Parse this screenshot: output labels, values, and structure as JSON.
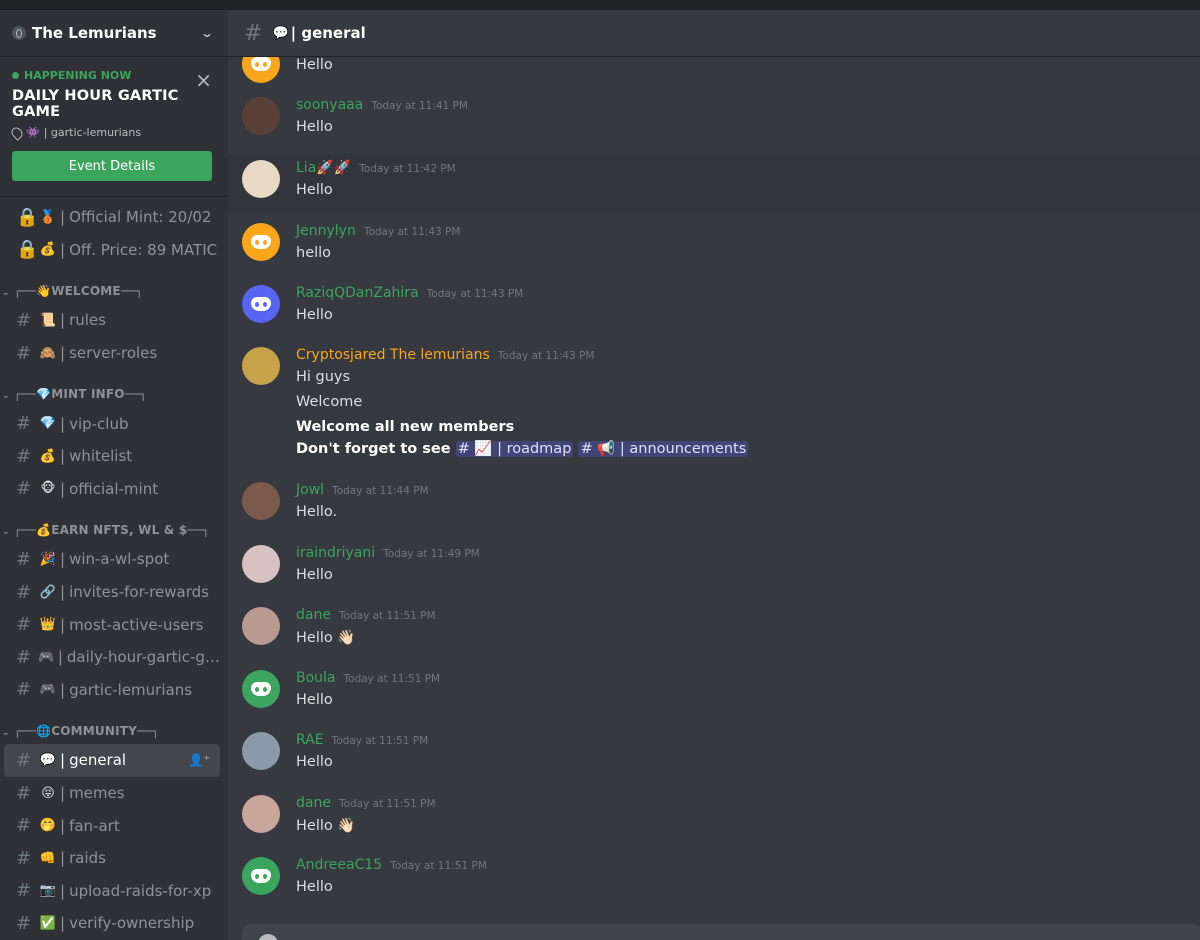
{
  "server": {
    "name": "The Lemurians"
  },
  "event": {
    "happening": "HAPPENING NOW",
    "title": "DAILY HOUR GARTIC GAME",
    "location_emoji": "👾",
    "location": "| gartic-lemurians",
    "button": "Event Details"
  },
  "sidebar": {
    "top_channels": [
      {
        "emoji": "🥉",
        "label": "Official Mint: 20/02"
      },
      {
        "emoji": "💰",
        "label": "Off. Price: 89 MATIC"
      }
    ],
    "categories": [
      {
        "emoji": "👋",
        "label": "WELCOME",
        "channels": [
          {
            "emoji": "📜",
            "label": "rules"
          },
          {
            "emoji": "🙈",
            "label": "server-roles"
          }
        ]
      },
      {
        "emoji": "💎",
        "label": "MINT INFO",
        "channels": [
          {
            "emoji": "💎",
            "label": "vip-club"
          },
          {
            "emoji": "💰",
            "label": "whitelist"
          },
          {
            "emoji": "🐵",
            "label": "official-mint"
          }
        ]
      },
      {
        "emoji": "💰",
        "label": "EARN NFTS, WL & $",
        "channels": [
          {
            "emoji": "🎉",
            "label": "win-a-wl-spot"
          },
          {
            "emoji": "🔗",
            "label": "invites-for-rewards"
          },
          {
            "emoji": "👑",
            "label": "most-active-users"
          },
          {
            "emoji": "🎮",
            "label": "daily-hour-gartic-ga..."
          },
          {
            "emoji": "🎮",
            "label": "gartic-lemurians"
          }
        ]
      },
      {
        "emoji": "🌐",
        "label": "COMMUNITY",
        "channels": [
          {
            "emoji": "💬",
            "label": "general",
            "active": true
          },
          {
            "emoji": "😝",
            "label": "memes"
          },
          {
            "emoji": "🤭",
            "label": "fan-art"
          },
          {
            "emoji": "👊",
            "label": "raids"
          },
          {
            "emoji": "📷",
            "label": "upload-raids-for-xp"
          },
          {
            "emoji": "✅",
            "label": "verify-ownership"
          }
        ]
      }
    ]
  },
  "channel_header": {
    "emoji": "💬",
    "title": "| general"
  },
  "colors": {
    "green_name": "#3ba55d",
    "orange_name": "#faa61a",
    "mention_bg": "#5865f2"
  },
  "messages": [
    {
      "author": "",
      "time": "",
      "avatar": "discord-orange",
      "lines": [
        "Hello"
      ]
    },
    {
      "author": "soonyaaa",
      "time": "Today at 11:41 PM",
      "avatar": "photo",
      "lines": [
        "Hello"
      ]
    },
    {
      "author": "Lia🚀🚀",
      "time": "Today at 11:42 PM",
      "avatar": "photo",
      "lines": [
        "Hello"
      ]
    },
    {
      "author": "Jennylyn",
      "time": "Today at 11:43 PM",
      "avatar": "discord-orange",
      "lines": [
        "hello"
      ]
    },
    {
      "author": "RaziqQDanZahira",
      "time": "Today at 11:43 PM",
      "avatar": "discord-blurple",
      "lines": [
        "Hello"
      ]
    },
    {
      "author": "Cryptosjared The lemurians",
      "time": "Today at 11:43 PM",
      "avatar": "photo",
      "lines": [
        "Hi guys",
        "Welcome",
        "Welcome all new members",
        "Don't forget to see"
      ],
      "mentions": [
        "📈 | roadmap",
        "📢 | announcements"
      ]
    },
    {
      "author": "Jowl",
      "time": "Today at 11:44 PM",
      "avatar": "photo",
      "lines": [
        "Hello."
      ]
    },
    {
      "author": "iraindriyani",
      "time": "Today at 11:49 PM",
      "avatar": "photo",
      "lines": [
        "Hello"
      ]
    },
    {
      "author": "dane",
      "time": "Today at 11:51 PM",
      "avatar": "photo",
      "lines": [
        "Hello 👋🏻"
      ]
    },
    {
      "author": "Boula",
      "time": "Today at 11:51 PM",
      "avatar": "discord-green",
      "lines": [
        "Hello"
      ]
    },
    {
      "author": "RAE",
      "time": "Today at 11:51 PM",
      "avatar": "photo",
      "lines": [
        "Hello"
      ]
    },
    {
      "author": "dane",
      "time": "Today at 11:51 PM",
      "avatar": "photo",
      "lines": [
        "Hello 👋🏻"
      ]
    },
    {
      "author": "AndreeaC15",
      "time": "Today at 11:51 PM",
      "avatar": "discord-green",
      "lines": [
        "Hello"
      ]
    }
  ]
}
